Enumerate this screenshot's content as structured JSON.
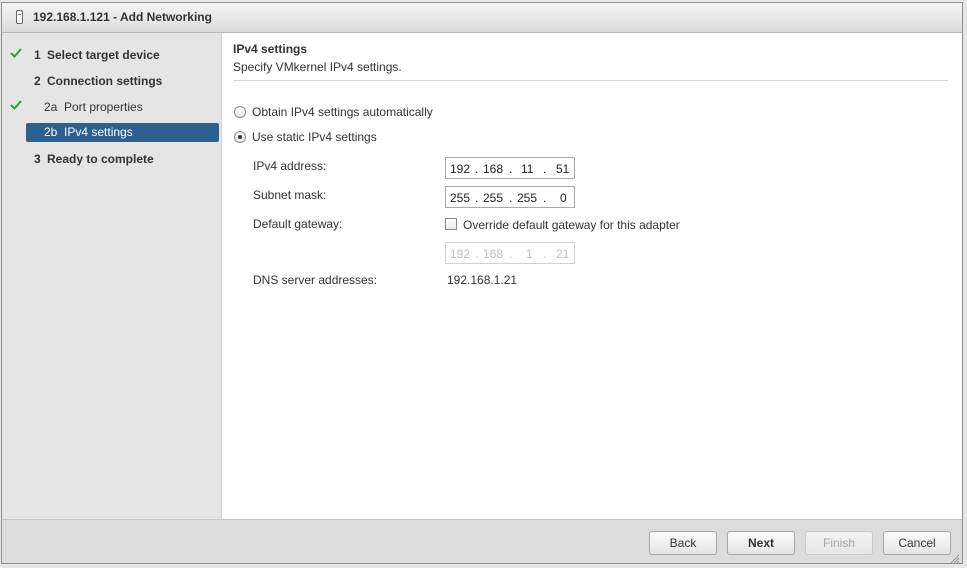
{
  "window": {
    "title": "192.168.1.121 - Add Networking"
  },
  "steps": [
    {
      "num": "1",
      "label": "Select target device",
      "done": true
    },
    {
      "num": "2",
      "label": "Connection settings",
      "done": false
    },
    {
      "num": "2a",
      "label": "Port properties",
      "done": true
    },
    {
      "num": "2b",
      "label": "IPv4 settings",
      "done": false,
      "active": true
    },
    {
      "num": "3",
      "label": "Ready to complete",
      "done": false
    }
  ],
  "main": {
    "title": "IPv4 settings",
    "description": "Specify VMkernel IPv4 settings.",
    "options": {
      "auto_label": "Obtain IPv4 settings automatically",
      "static_label": "Use static IPv4 settings",
      "selected": "static"
    },
    "fields": {
      "ipv4_label": "IPv4 address:",
      "ipv4": [
        "192",
        "168",
        "11",
        "51"
      ],
      "subnet_label": "Subnet mask:",
      "subnet": [
        "255",
        "255",
        "255",
        "0"
      ],
      "gateway_label": "Default gateway:",
      "override_label": "Override default gateway for this adapter",
      "override_checked": false,
      "gateway_placeholder": [
        "192",
        "168",
        "1",
        "21"
      ],
      "dns_label": "DNS server addresses:",
      "dns_value": "192.168.1.21"
    },
    "dot": "."
  },
  "footer": {
    "back": "Back",
    "next": "Next",
    "finish": "Finish",
    "cancel": "Cancel"
  },
  "colors": {
    "accent": "#2d5f8f",
    "check": "#3a9a3a"
  }
}
